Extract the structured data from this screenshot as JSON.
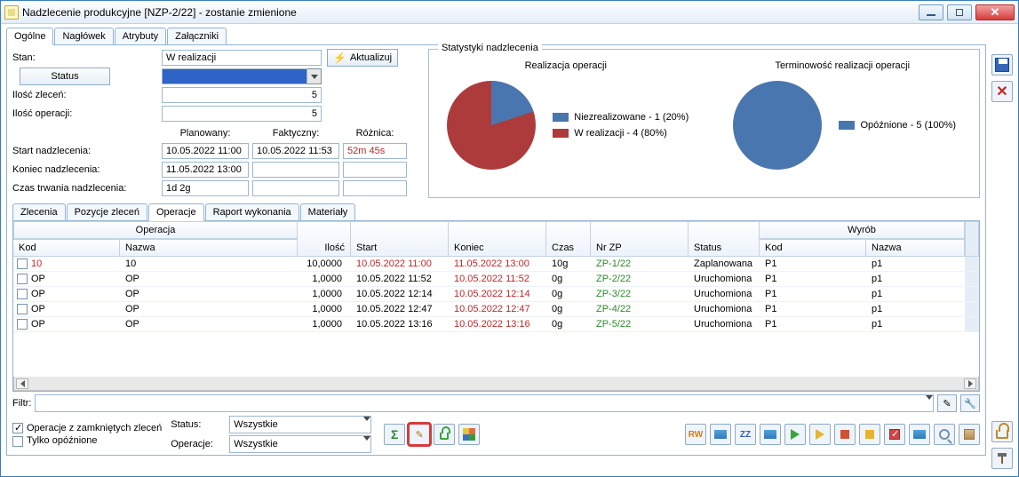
{
  "window": {
    "title": "Nadzlecenie produkcyjne [NZP-2/22] - zostanie zmienione"
  },
  "top_tabs": {
    "0": "Ogólne",
    "1": "Nagłówek",
    "2": "Atrybuty",
    "3": "Załączniki"
  },
  "main": {
    "stan_label": "Stan:",
    "stan_value": "W realizacji",
    "status_btn": "Status",
    "ilosc_zlecen_label": "Ilość zleceń:",
    "ilosc_zlecen_value": "5",
    "ilosc_operacji_label": "Ilość operacji:",
    "ilosc_operacji_value": "5",
    "aktualizuj": "Aktualizuj",
    "plan_label": "Planowany:",
    "fakt_label": "Faktyczny:",
    "roz_label": "Różnica:",
    "start_label": "Start nadzlecenia:",
    "start_plan": "10.05.2022 11:00",
    "start_fakt": "10.05.2022 11:53",
    "start_roz": "52m 45s",
    "koniec_label": "Koniec nadzlecenia:",
    "koniec_plan": "11.05.2022 13:00",
    "czas_label": "Czas trwania nadzlecenia:",
    "czas_plan": "1d 2g"
  },
  "stats": {
    "panel_title": "Statystyki nadzlecenia",
    "chart1_title": "Realizacja operacji",
    "chart1_legend1": "Niezrealizowane - 1 (20%)",
    "chart1_legend2": "W realizacji - 4 (80%)",
    "chart2_title": "Terminowość realizacji operacji",
    "chart2_legend1": "Opóźnione - 5 (100%)"
  },
  "chart_data": [
    {
      "type": "pie",
      "title": "Realizacja operacji",
      "series": [
        {
          "name": "Niezrealizowane",
          "value": 1,
          "pct": 20,
          "color": "#4a76b0"
        },
        {
          "name": "W realizacji",
          "value": 4,
          "pct": 80,
          "color": "#ae3b3b"
        }
      ]
    },
    {
      "type": "pie",
      "title": "Terminowość realizacji operacji",
      "series": [
        {
          "name": "Opóźnione",
          "value": 5,
          "pct": 100,
          "color": "#4a76b0"
        }
      ]
    }
  ],
  "low_tabs": {
    "0": "Zlecenia",
    "1": "Pozycje zleceń",
    "2": "Operacje",
    "3": "Raport wykonania",
    "4": "Materiały"
  },
  "table": {
    "group_operacja": "Operacja",
    "group_wyrob": "Wyrób",
    "h_kod": "Kod",
    "h_nazwa": "Nazwa",
    "h_ilosc": "Ilość",
    "h_start": "Start",
    "h_koniec": "Koniec",
    "h_czas": "Czas",
    "h_nrzp": "Nr ZP",
    "h_status": "Status",
    "h_wkod": "Kod",
    "h_wnazwa": "Nazwa",
    "rows": [
      {
        "kod": "10",
        "nazwa": "10",
        "ilosc": "10,0000",
        "start": "10.05.2022 11:00",
        "koniec": "11.05.2022 13:00",
        "czas": "10g",
        "nrzp": "ZP-1/22",
        "status": "Zaplanowana",
        "wkod": "P1",
        "wnazwa": "p1",
        "start_red": true,
        "koniec_red": true,
        "kod_red": true
      },
      {
        "kod": "OP",
        "nazwa": "OP",
        "ilosc": "1,0000",
        "start": "10.05.2022 11:52",
        "koniec": "10.05.2022 11:52",
        "czas": "0g",
        "nrzp": "ZP-2/22",
        "status": "Uruchomiona",
        "wkod": "P1",
        "wnazwa": "p1",
        "koniec_red": true
      },
      {
        "kod": "OP",
        "nazwa": "OP",
        "ilosc": "1,0000",
        "start": "10.05.2022 12:14",
        "koniec": "10.05.2022 12:14",
        "czas": "0g",
        "nrzp": "ZP-3/22",
        "status": "Uruchomiona",
        "wkod": "P1",
        "wnazwa": "p1",
        "koniec_red": true
      },
      {
        "kod": "OP",
        "nazwa": "OP",
        "ilosc": "1,0000",
        "start": "10.05.2022 12:47",
        "koniec": "10.05.2022 12:47",
        "czas": "0g",
        "nrzp": "ZP-4/22",
        "status": "Uruchomiona",
        "wkod": "P1",
        "wnazwa": "p1",
        "koniec_red": true
      },
      {
        "kod": "OP",
        "nazwa": "OP",
        "ilosc": "1,0000",
        "start": "10.05.2022 13:16",
        "koniec": "10.05.2022 13:16",
        "czas": "0g",
        "nrzp": "ZP-5/22",
        "status": "Uruchomiona",
        "wkod": "P1",
        "wnazwa": "p1",
        "koniec_red": true
      }
    ]
  },
  "filter": {
    "label": "Filtr:",
    "chk1": "Operacje z zamkniętych zleceń",
    "chk2": "Tylko opóźnione",
    "status_label": "Status:",
    "status_value": "Wszystkie",
    "oper_label": "Operacje:",
    "oper_value": "Wszystkie"
  },
  "colors": {
    "blue": "#4a76b0",
    "red": "#ae3b3b"
  }
}
